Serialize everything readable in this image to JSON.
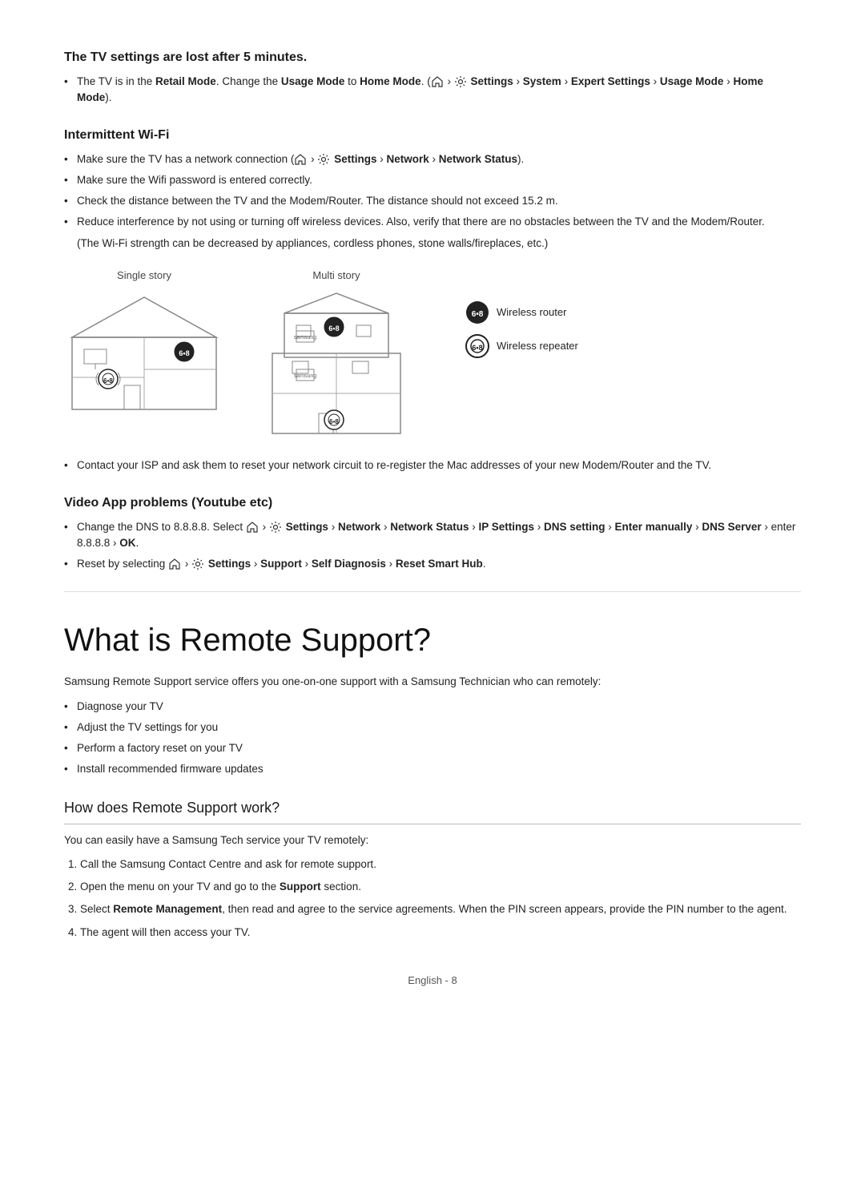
{
  "sections": {
    "tv_settings_lost": {
      "heading": "The TV settings are lost after 5 minutes.",
      "bullet": "The TV is in the",
      "retail_mode": "Retail Mode",
      "bullet_cont": ". Change the",
      "usage_mode": "Usage Mode",
      "bullet_cont2": " to",
      "home_mode": "Home Mode",
      "nav": "Settings › System › Expert Settings › Usage Mode › Home Mode",
      "nav_prefix": ". ("
    },
    "intermittent_wifi": {
      "heading": "Intermittent Wi-Fi",
      "bullets": [
        {
          "prefix": "Make sure the TV has a network connection (",
          "nav": "Settings › Network › Network Status",
          "suffix": ")."
        },
        {
          "text": "Make sure the Wifi password is entered correctly."
        },
        {
          "text": "Check the distance between the TV and the Modem/Router. The distance should not exceed 15.2 m."
        },
        {
          "text": "Reduce interference by not using or turning off wireless devices. Also, verify that there are no obstacles between the TV and the Modem/Router."
        }
      ],
      "note": "(The Wi-Fi strength can be decreased by appliances, cordless phones, stone walls/fireplaces, etc.)",
      "diagram": {
        "single_story_label": "Single story",
        "multi_story_label": "Multi story",
        "legend": [
          {
            "label": "Wireless router",
            "icon": "router"
          },
          {
            "label": "Wireless repeater",
            "icon": "repeater"
          }
        ]
      },
      "contact_bullet": "Contact your ISP and ask them to reset your network circuit to re-register the Mac addresses of your new Modem/Router and the TV."
    },
    "video_app_problems": {
      "heading": "Video App problems (Youtube etc)",
      "bullets": [
        {
          "prefix": "Change the DNS to 8.8.8.8. Select",
          "nav": "Settings › Network › Network Status › IP Settings › DNS setting › Enter manually › DNS Server",
          "suffix": "› enter 8.8.8.8 › OK."
        },
        {
          "prefix": "Reset by selecting",
          "nav": "Settings › Support › Self Diagnosis › Reset Smart Hub",
          "suffix": "."
        }
      ]
    },
    "remote_support": {
      "heading": "What is Remote Support?",
      "intro": "Samsung Remote Support service offers you one-on-one support with a Samsung Technician who can remotely:",
      "bullets": [
        "Diagnose your TV",
        "Adjust the TV settings for you",
        "Perform a factory reset on your TV",
        "Install recommended firmware updates"
      ]
    },
    "how_does_remote_support": {
      "heading": "How does Remote Support work?",
      "intro": "You can easily have a Samsung Tech service your TV remotely:",
      "steps": [
        "Call the Samsung Contact Centre and ask for remote support.",
        {
          "prefix": "Open the menu on your TV and go to the ",
          "bold": "Support",
          "suffix": " section."
        },
        {
          "prefix": "Select ",
          "bold": "Remote Management",
          "suffix": ", then read and agree to the service agreements. When the PIN screen appears, provide the PIN number to the agent."
        },
        "The agent will then access your TV."
      ]
    }
  },
  "footer": {
    "text": "English - 8"
  },
  "icons": {
    "home": "⌂",
    "settings": "⚙",
    "arrow": "›",
    "bullet": "•"
  }
}
